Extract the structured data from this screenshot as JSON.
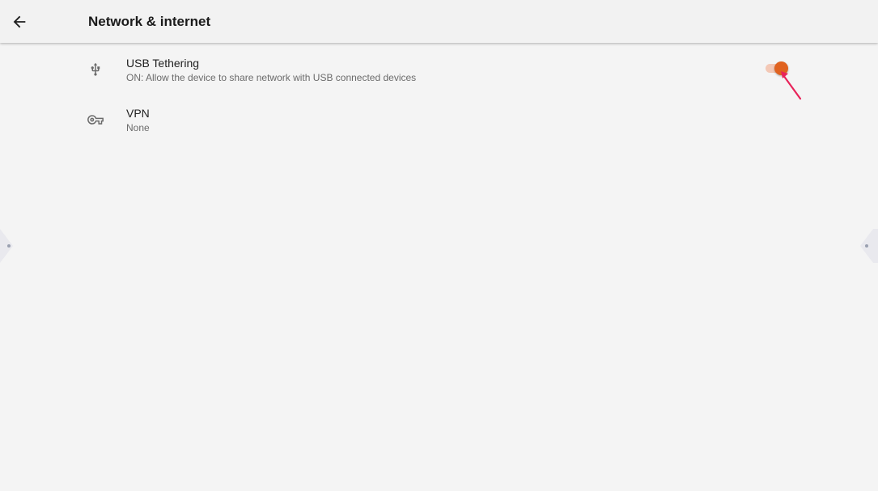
{
  "appbar": {
    "title": "Network & internet",
    "back_icon": "arrow-back-icon"
  },
  "settings": [
    {
      "title": "USB Tethering",
      "summary": "ON: Allow the device to share network with USB connected devices",
      "icon": "usb-icon",
      "toggle": {
        "on": true
      }
    },
    {
      "title": "VPN",
      "summary": "None",
      "icon": "vpn-key-icon"
    }
  ],
  "colors": {
    "background": "#f4f4f4",
    "accent": "#e0621f",
    "track": "#f3c8b6",
    "pointer": "#e8245a"
  }
}
